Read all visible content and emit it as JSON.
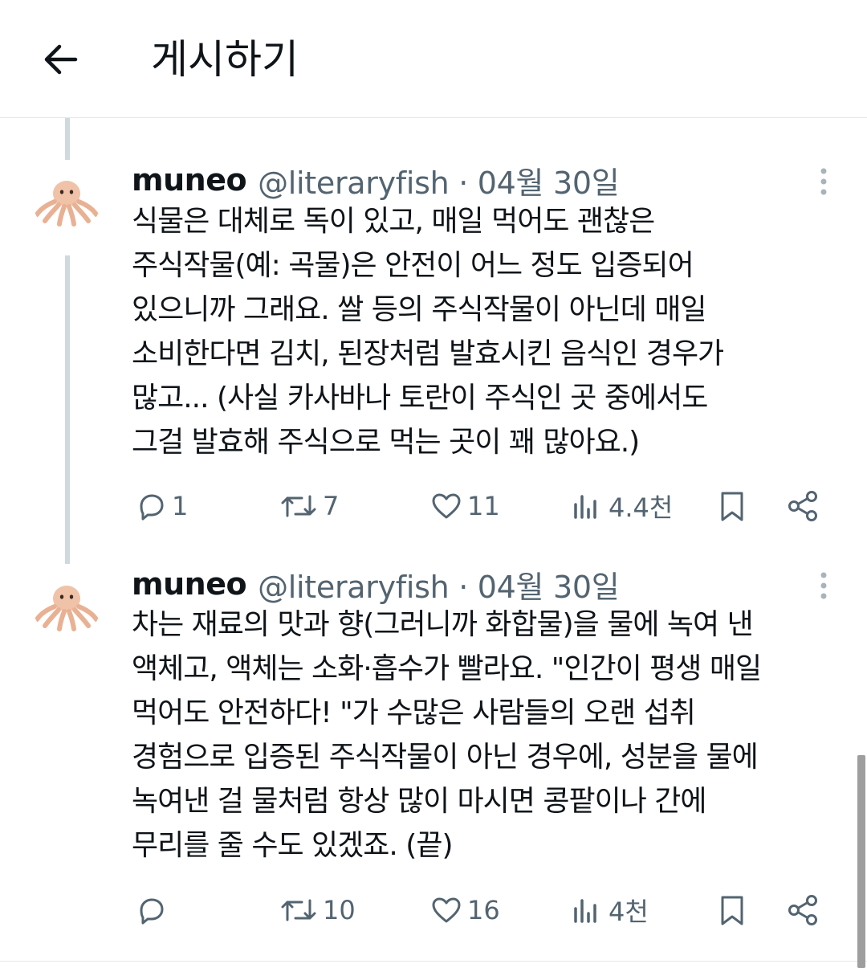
{
  "header": {
    "title": "게시하기"
  },
  "tweets": [
    {
      "name": "muneo",
      "handle": "@literaryfish",
      "separator": "·",
      "date": "04월 30일",
      "lines": [
        "식물은 대체로 독이 있고, 매일 먹어도 괜찮은",
        "주식작물(예: 곡물)은 안전이 어느 정도 입증되어",
        "있으니까 그래요. 쌀 등의 주식작물이 아닌데 매일",
        "소비한다면 김치, 된장처럼 발효시킨 음식인 경우가",
        "많고... (사실 카사바나 토란이 주식인 곳 중에서도",
        "그걸 발효해 주식으로 먹는 곳이 꽤 많아요.)"
      ],
      "replies": "1",
      "retweets": "7",
      "likes": "11",
      "views": "4.4천"
    },
    {
      "name": "muneo",
      "handle": "@literaryfish",
      "separator": "·",
      "date": "04월 30일",
      "lines": [
        "차는 재료의 맛과 향(그러니까 화합물)을 물에 녹여 낸",
        "액체고, 액체는 소화·흡수가 빨라요. \"인간이 평생 매일",
        "먹어도 안전하다! \"가 수많은 사람들의 오랜 섭취",
        "경험으로 입증된 주식작물이 아닌 경우에, 성분을 물에",
        "녹여낸 걸 물처럼 항상 많이 마시면 콩팥이나 간에",
        "무리를 줄 수도 있겠죠. (끝)"
      ],
      "replies": "",
      "retweets": "10",
      "likes": "16",
      "views": "4천"
    }
  ],
  "icons": {
    "back": "arrow-left-icon",
    "more": "more-vertical-icon",
    "reply": "reply-icon",
    "retweet": "retweet-icon",
    "like": "heart-icon",
    "views": "views-icon",
    "bookmark": "bookmark-icon",
    "share": "share-icon",
    "avatar": "octopus-avatar"
  },
  "colors": {
    "text": "#0f1419",
    "muted": "#536471",
    "thread_line": "#cfd9de",
    "divider": "#e6e6e6"
  }
}
